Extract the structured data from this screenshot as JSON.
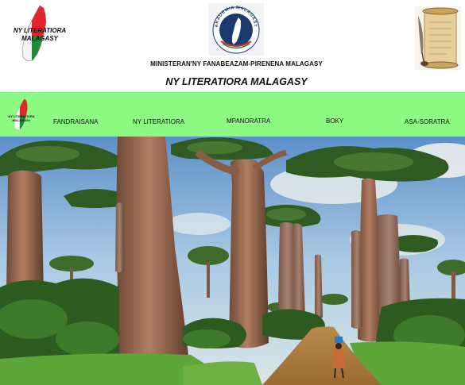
{
  "header": {
    "logo_text_line1": "NY LITERATIORA",
    "logo_text_line2": "MALAGASY",
    "seal_text": "AKADEMIA MALAGASY",
    "ministry": "MINISTERAN'NY FANABEAZAM-PIRENENA MALAGASY",
    "title": "NY LITERATIORA MALAGASY"
  },
  "nav": {
    "logo_text_line1": "NY LITERATIORA",
    "logo_text_line2": "MALAGASY",
    "items": [
      {
        "label": "FANDRAISANA"
      },
      {
        "label": "NY LITERATIORA"
      },
      {
        "label": "MPANORATRA"
      },
      {
        "label": "BOKY"
      },
      {
        "label": "ASA-SORATRA"
      }
    ]
  },
  "icons": {
    "logo": "madagascar-flag-map-icon",
    "seal": "akademia-seal-icon",
    "scroll": "parchment-quill-icon"
  },
  "colors": {
    "nav_background": "#8cf983",
    "flag_red": "#e0262b",
    "flag_green": "#1f8a3b",
    "seal_navy": "#1d3a6e"
  }
}
